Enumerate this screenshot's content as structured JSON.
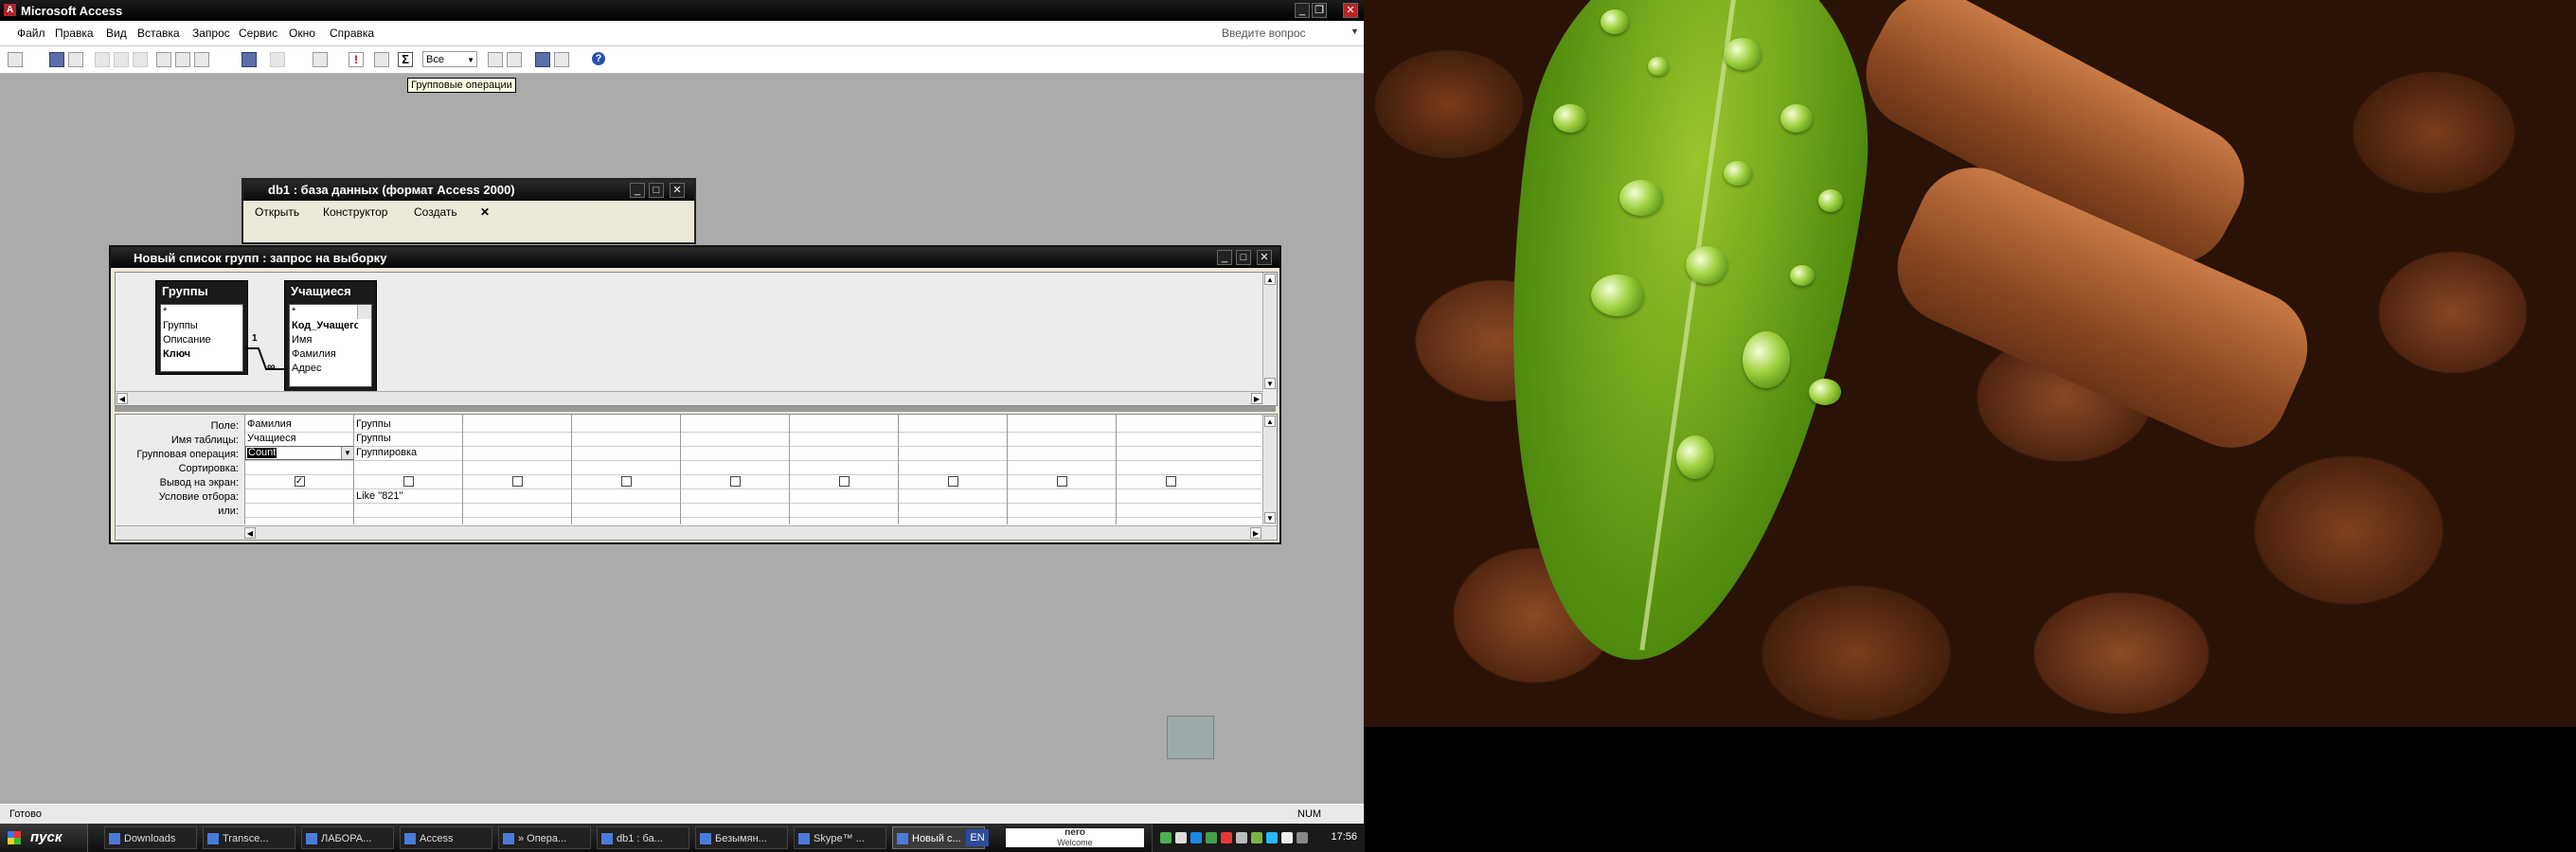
{
  "app": {
    "title": "Microsoft Access",
    "menu": [
      "Файл",
      "Правка",
      "Вид",
      "Вставка",
      "Запрос",
      "Сервис",
      "Окно",
      "Справка"
    ],
    "ask_placeholder": "Введите вопрос",
    "toolbar_combo_value": "Все",
    "tooltip": "Групповые операции",
    "status_left": "Готово",
    "status_num": "NUM"
  },
  "db_window": {
    "title": "db1 : база данных (формат Access 2000)",
    "buttons": [
      "Открыть",
      "Конструктор",
      "Создать"
    ]
  },
  "query_window": {
    "title": "Новый список групп : запрос на выборку",
    "tables": [
      {
        "name": "Группы",
        "fields": [
          "*",
          "Группы",
          "Описание",
          "Ключ"
        ]
      },
      {
        "name": "Учащиеся",
        "fields": [
          "*",
          "Код_Учащегося",
          "Имя",
          "Фамилия",
          "Адрес"
        ]
      }
    ],
    "join": {
      "one": "1",
      "many": "∞"
    },
    "row_labels": [
      "Поле:",
      "Имя таблицы:",
      "Групповая операция:",
      "Сортировка:",
      "Вывод на экран:",
      "Условие отбора:",
      "или:"
    ],
    "columns": [
      {
        "field": "Фамилия",
        "table": "Учащиеся",
        "total": "Count",
        "show": true,
        "criteria": ""
      },
      {
        "field": "Группы",
        "table": "Группы",
        "total": "Группировка",
        "show": false,
        "criteria": "Like \"821\""
      },
      {
        "field": "",
        "table": "",
        "total": "",
        "show": false,
        "criteria": ""
      },
      {
        "field": "",
        "table": "",
        "total": "",
        "show": false,
        "criteria": ""
      },
      {
        "field": "",
        "table": "",
        "total": "",
        "show": false,
        "criteria": ""
      },
      {
        "field": "",
        "table": "",
        "total": "",
        "show": false,
        "criteria": ""
      },
      {
        "field": "",
        "table": "",
        "total": "",
        "show": false,
        "criteria": ""
      },
      {
        "field": "",
        "table": "",
        "total": "",
        "show": false,
        "criteria": ""
      },
      {
        "field": "",
        "table": "",
        "total": "",
        "show": false,
        "criteria": ""
      }
    ]
  },
  "taskbar": {
    "start": "пуск",
    "tasks": [
      "Downloads",
      "Transce...",
      "ЛАБОРА...",
      "Access",
      "» Опера...",
      "db1 : ба...",
      "Безымян...",
      "Skype™ ...",
      "Новый с..."
    ],
    "lang": "EN",
    "nero": "nero",
    "nero_sub": "Welcome",
    "clock": "17:56"
  }
}
